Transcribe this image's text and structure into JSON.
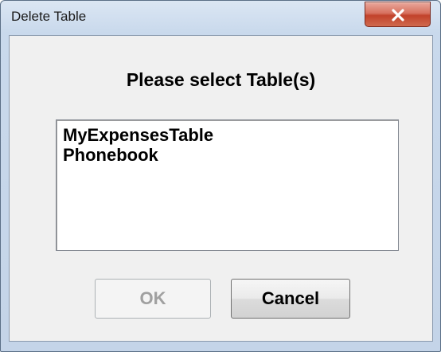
{
  "window": {
    "title": "Delete Table"
  },
  "dialog": {
    "prompt": "Please select Table(s)",
    "tables": [
      "MyExpensesTable",
      "Phonebook"
    ],
    "ok_label": "OK",
    "cancel_label": "Cancel",
    "ok_enabled": false
  },
  "icons": {
    "close": "close-icon"
  },
  "colors": {
    "close_button": "#c7442f",
    "frame": "#c4d4e8",
    "client": "#f0f0f0",
    "disabled_text": "#a0a0a0"
  }
}
